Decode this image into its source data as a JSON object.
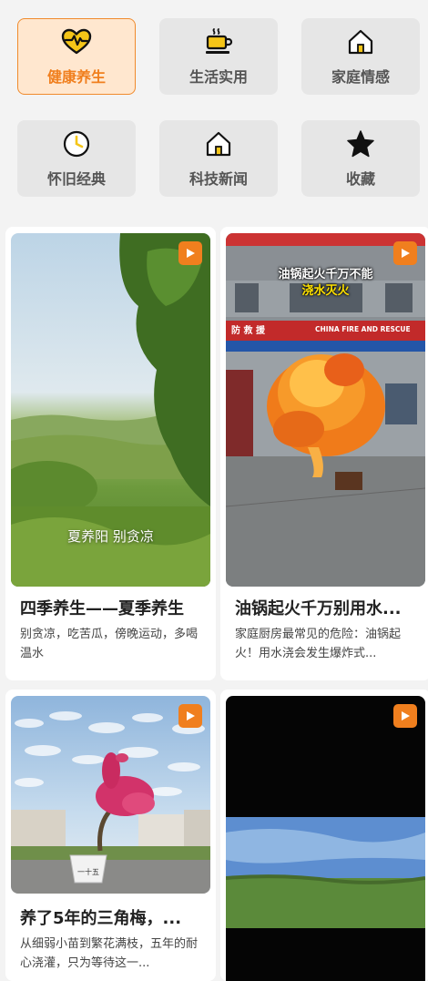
{
  "categories": [
    {
      "label": "健康养生",
      "icon": "heart-pulse-icon",
      "active": true
    },
    {
      "label": "生活实用",
      "icon": "coffee-cup-icon",
      "active": false
    },
    {
      "label": "家庭情感",
      "icon": "house-icon",
      "active": false
    },
    {
      "label": "怀旧经典",
      "icon": "clock-icon",
      "active": false
    },
    {
      "label": "科技新闻",
      "icon": "house-icon",
      "active": false
    },
    {
      "label": "收藏",
      "icon": "star-icon",
      "active": false
    }
  ],
  "videos": [
    {
      "title": "四季养生——夏季养生",
      "description": "别贪凉，吃苦瓜，傍晚运动，多喝温水",
      "overlay": "夏养阳 别贪凉"
    },
    {
      "title": "油锅起火千万别用水...",
      "description": "家庭厨房最常见的危险：油锅起火！用水浇会发生爆炸式...",
      "overlay_line1": "油锅起火千万不能",
      "overlay_line2": "浇水灭火",
      "sign": "防 救 援",
      "sign_en": "CHINA FIRE AND RESCUE"
    },
    {
      "title": "养了5年的三角梅，...",
      "description": "从细弱小苗到繁花满枝，五年的耐心浇灌，只为等待这一...",
      "pot_text": "一十五"
    },
    {
      "title": "",
      "description": ""
    }
  ],
  "colors": {
    "accent": "#f07f1e",
    "active_bg": "#ffe7cf",
    "tile_bg": "#e6e6e6"
  }
}
